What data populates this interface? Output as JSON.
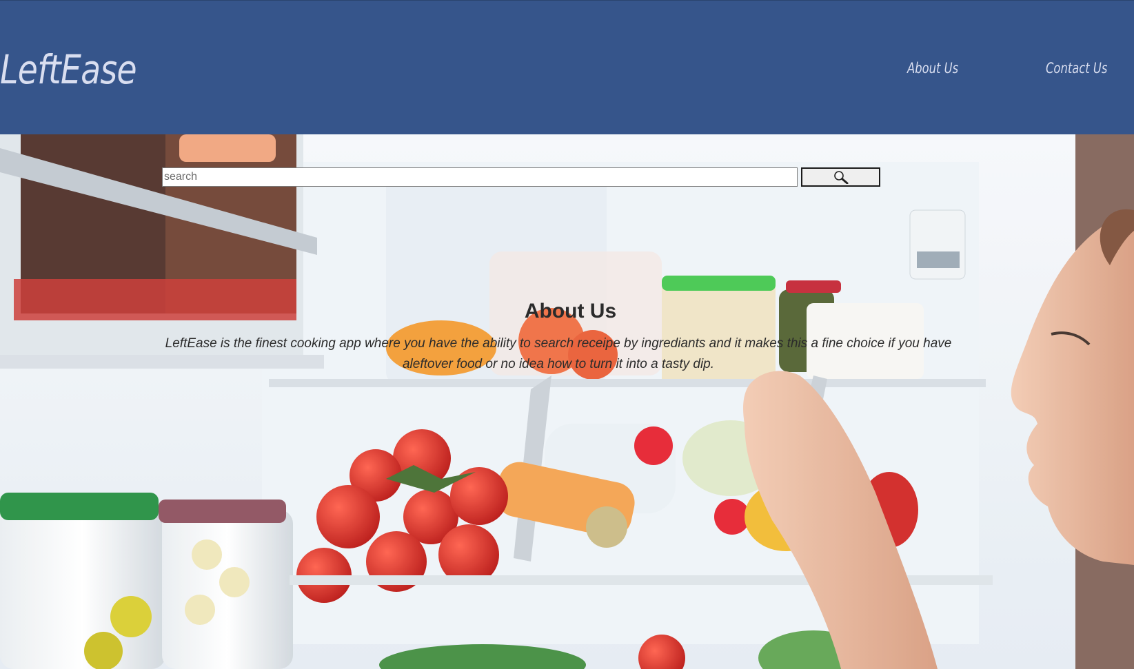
{
  "header": {
    "logo": "LeftEase",
    "nav": [
      {
        "label": "About Us"
      },
      {
        "label": "Contact Us"
      }
    ]
  },
  "search": {
    "placeholder": "search",
    "value": "",
    "button_icon": "magnifier-icon"
  },
  "about": {
    "title": "About Us",
    "text": "LeftEase is the finest cooking app where you have the ability to search receipe by ingrediants and it makes this a fine choice if you have aleftover food or no idea how to turn it into a tasty dip."
  },
  "colors": {
    "header_bg": "#36558b",
    "header_text": "#d9def0",
    "body_text": "#2b2b2b"
  },
  "hero_image": "photo of a woman reaching into an open refrigerator full of vegetables"
}
